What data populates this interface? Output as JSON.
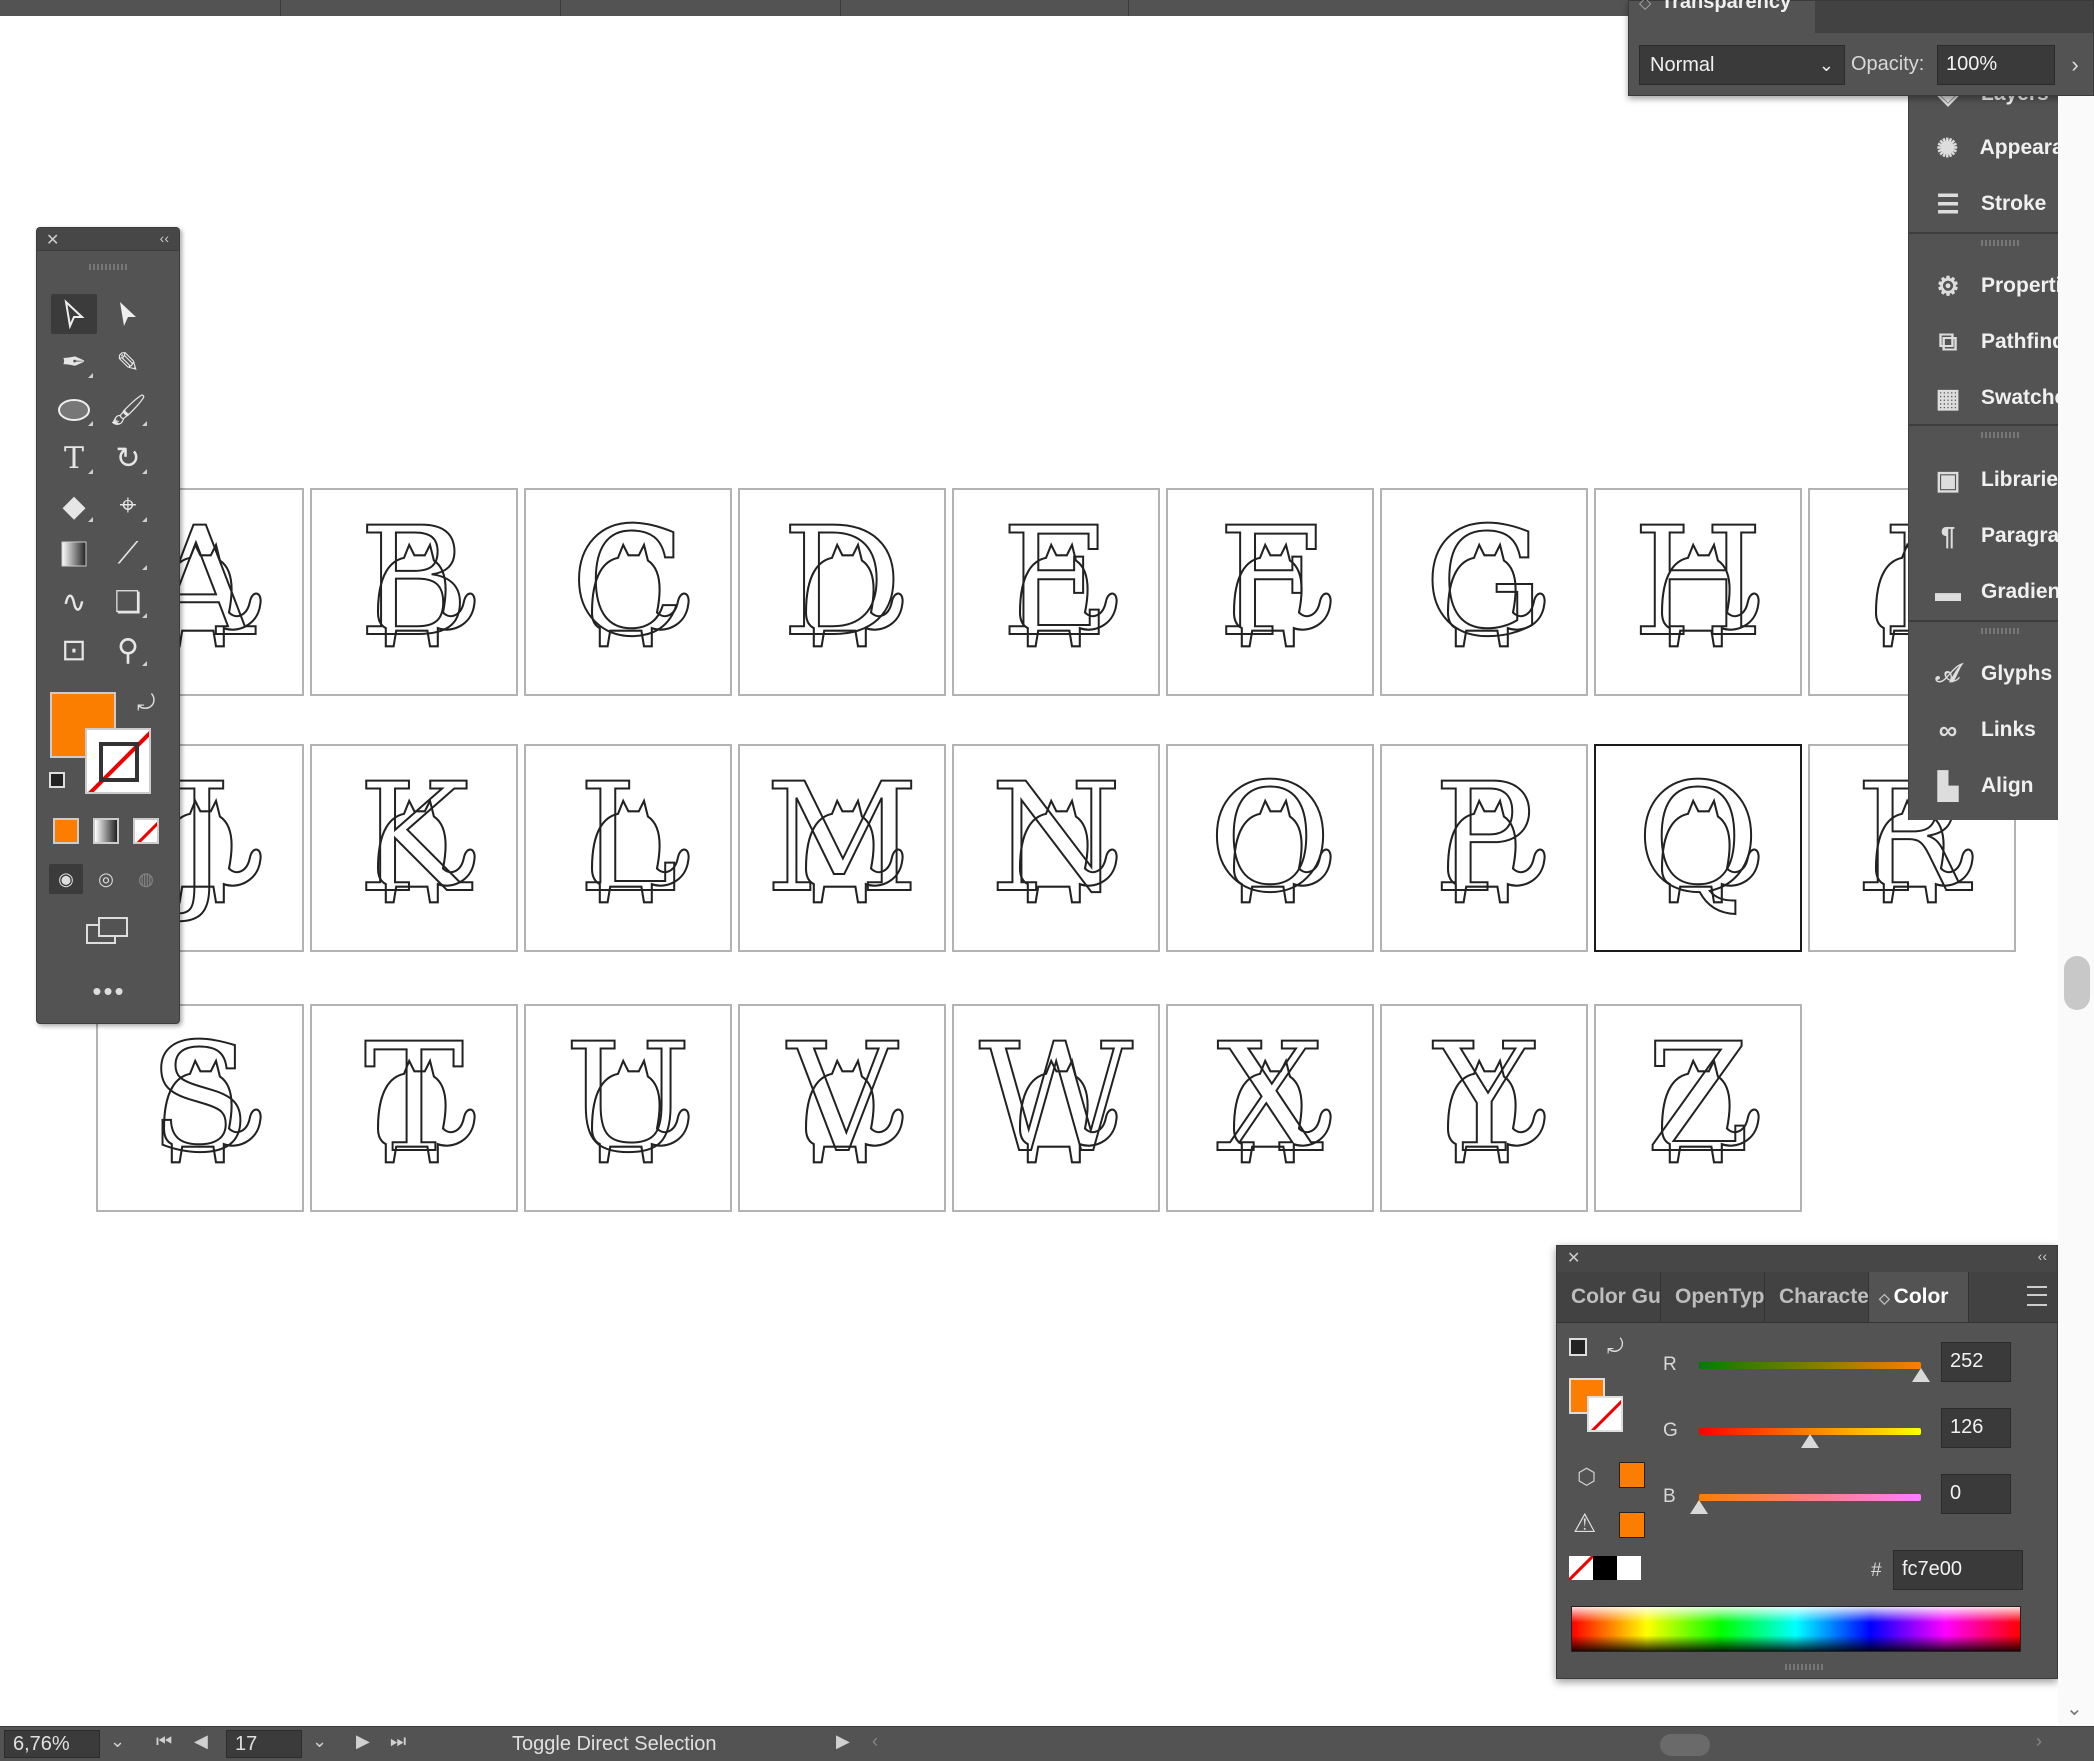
{
  "transparency": {
    "title": "Transparency",
    "blend_mode": "Normal",
    "opacity_label": "Opacity:",
    "opacity_value": "100%"
  },
  "dock": {
    "layers_label": "Layers",
    "items": [
      {
        "label": "Appearance",
        "icon": "appearance-icon"
      },
      {
        "label": "Stroke",
        "icon": "stroke-icon"
      },
      {
        "label": "Properties",
        "icon": "properties-icon"
      },
      {
        "label": "Pathfinder",
        "icon": "pathfinder-icon"
      },
      {
        "label": "Swatches",
        "icon": "swatches-icon"
      },
      {
        "label": "Libraries",
        "icon": "libraries-icon"
      },
      {
        "label": "Paragraph",
        "icon": "paragraph-icon"
      },
      {
        "label": "Gradient",
        "icon": "gradient-icon"
      },
      {
        "label": "Glyphs",
        "icon": "glyphs-icon"
      },
      {
        "label": "Links",
        "icon": "links-icon"
      },
      {
        "label": "Align",
        "icon": "align-icon"
      }
    ]
  },
  "artboards": {
    "row1": [
      "A",
      "B",
      "C",
      "D",
      "E",
      "F",
      "G",
      "H",
      "I"
    ],
    "row2": [
      "J",
      "K",
      "L",
      "M",
      "N",
      "O",
      "P",
      "Q",
      "R"
    ],
    "row3": [
      "S",
      "T",
      "U",
      "V",
      "W",
      "X",
      "Y",
      "Z"
    ],
    "selected": "Q"
  },
  "color_panel": {
    "tabs": [
      "Color Gu",
      "OpenTyp",
      "Characte",
      "Color"
    ],
    "active_tab": "Color",
    "r_label": "R",
    "r_value": "252",
    "g_label": "G",
    "g_value": "126",
    "b_label": "B",
    "b_value": "0",
    "hash_label": "#",
    "hex_value": "fc7e00",
    "fill_color": "#fc7e00"
  },
  "tools": {
    "fill_color": "#fc7e00"
  },
  "status": {
    "zoom": "6,76%",
    "artboard_number": "17",
    "tool_hint": "Toggle Direct Selection"
  }
}
